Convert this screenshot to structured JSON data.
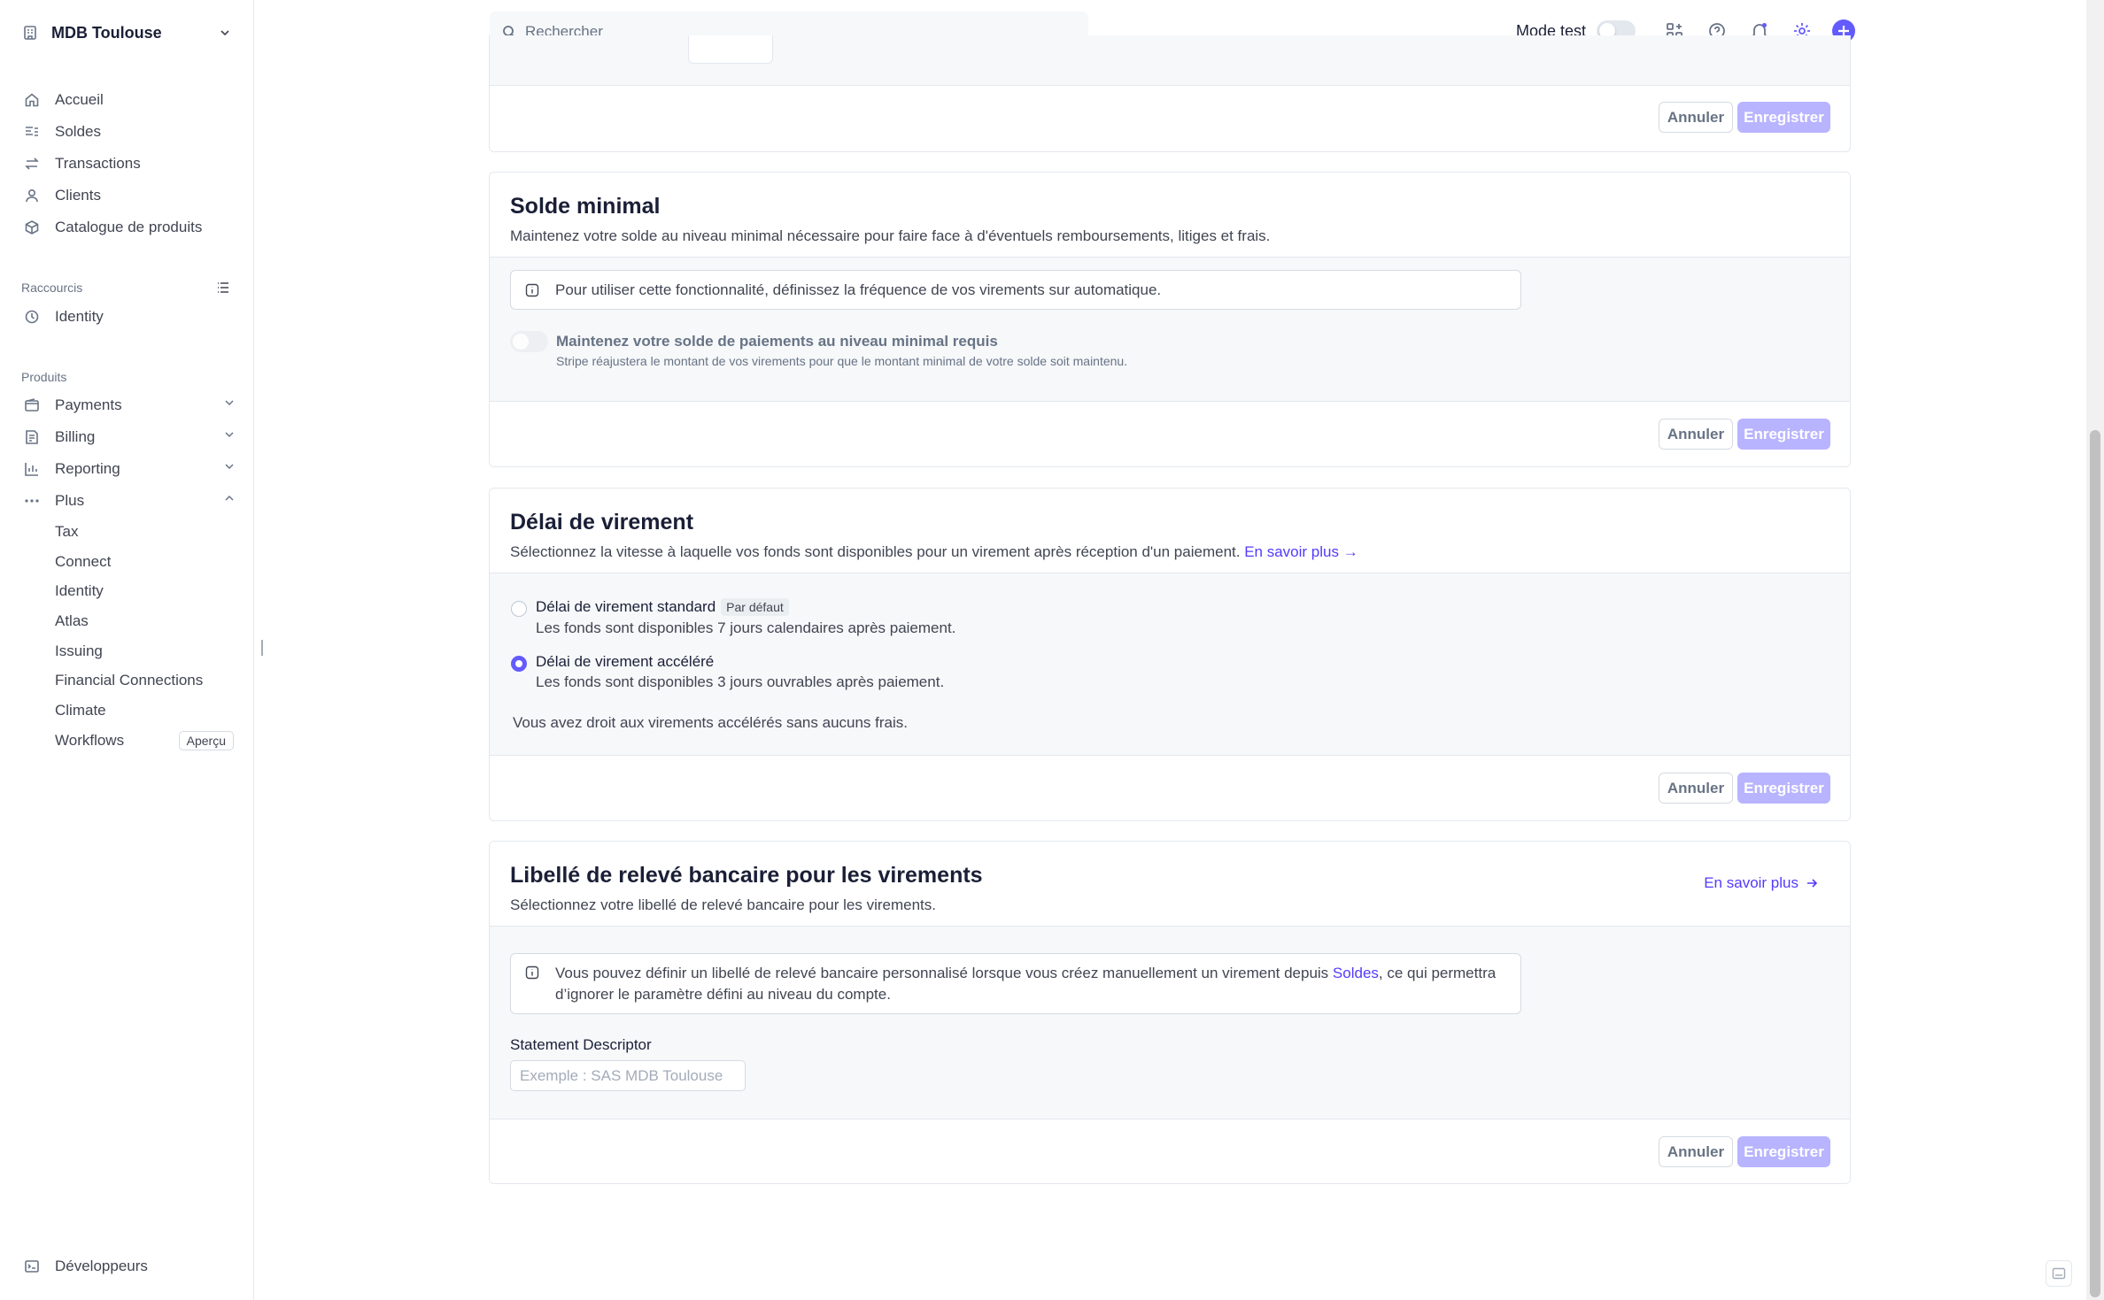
{
  "sidebar": {
    "account_name": "MDB Toulouse",
    "main_items": [
      {
        "label": "Accueil",
        "icon": "home-icon"
      },
      {
        "label": "Soldes",
        "icon": "balances-icon"
      },
      {
        "label": "Transactions",
        "icon": "transactions-icon"
      },
      {
        "label": "Clients",
        "icon": "person-icon"
      },
      {
        "label": "Catalogue de produits",
        "icon": "box-icon"
      }
    ],
    "shortcuts_label": "Raccourcis",
    "shortcuts": [
      {
        "label": "Identity",
        "icon": "clock-icon"
      }
    ],
    "products_label": "Produits",
    "products": [
      {
        "label": "Payments",
        "icon": "wallet-icon"
      },
      {
        "label": "Billing",
        "icon": "billing-icon"
      },
      {
        "label": "Reporting",
        "icon": "chart-icon"
      },
      {
        "label": "Plus",
        "icon": "more-icon"
      }
    ],
    "plus_items": [
      "Tax",
      "Connect",
      "Identity",
      "Atlas",
      "Issuing",
      "Financial Connections",
      "Climate",
      "Workflows"
    ],
    "workflows_badge": "Aperçu",
    "developers_label": "Développeurs"
  },
  "topbar": {
    "search_placeholder": "Rechercher",
    "mode_label": "Mode test"
  },
  "cards": {
    "top": {
      "cancel": "Annuler",
      "save": "Enregistrer"
    },
    "solde": {
      "title": "Solde minimal",
      "desc": "Maintenez votre solde au niveau minimal nécessaire pour faire face à d'éventuels remboursements, litiges et frais.",
      "info": "Pour utiliser cette fonctionnalité, définissez la fréquence de vos virements sur automatique.",
      "toggle_label": "Maintenez votre solde de paiements au niveau minimal requis",
      "toggle_help": "Stripe réajustera le montant de vos virements pour que le montant minimal de votre solde soit maintenu.",
      "cancel": "Annuler",
      "save": "Enregistrer"
    },
    "delai": {
      "title": "Délai de virement",
      "desc": "Sélectionnez la vitesse à laquelle vos fonds sont disponibles pour un virement après réception d'un paiement.",
      "link": "En savoir plus →",
      "option1_label": "Délai de virement standard",
      "option1_tag": "Par défaut",
      "option1_help": "Les fonds sont disponibles 7 jours calendaires après paiement.",
      "option2_label": "Délai de virement accéléré",
      "option2_help": "Les fonds sont disponibles 3 jours ouvrables après paiement.",
      "note": "Vous avez droit aux virements accélérés sans aucuns frais.",
      "cancel": "Annuler",
      "save": "Enregistrer"
    },
    "libelle": {
      "title": "Libellé de relevé bancaire pour les virements",
      "desc": "Sélectionnez votre libellé de relevé bancaire pour les virements.",
      "link": "En savoir plus",
      "info_before": "Vous pouvez définir un libellé de relevé bancaire personnalisé lorsque vous créez manuellement un virement depuis ",
      "info_link": "Soldes",
      "info_after": ", ce qui permettra",
      "info_line2": "d’ignorer le paramètre défini au niveau du compte.",
      "field_label": "Statement Descriptor",
      "field_placeholder": "Exemple : SAS MDB Toulouse",
      "cancel": "Annuler",
      "save": "Enregistrer"
    }
  }
}
